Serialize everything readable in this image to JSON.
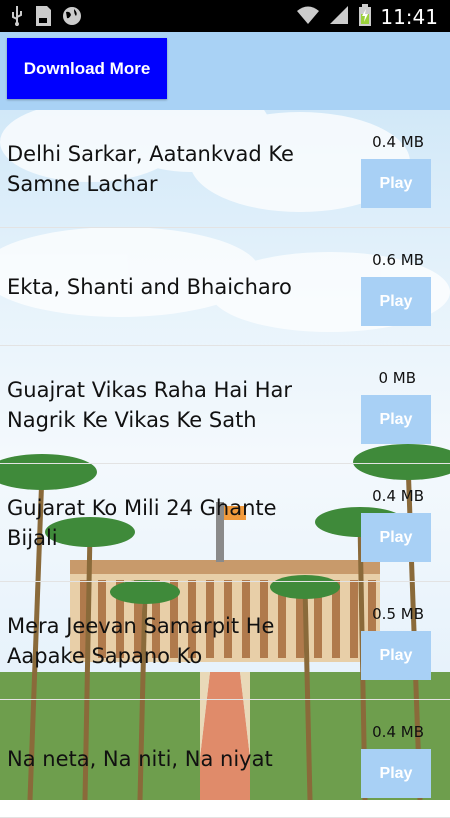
{
  "status_bar": {
    "time": "11:41",
    "icons": [
      "usb-icon",
      "sd-card-icon",
      "globe-icon",
      "wifi-icon",
      "signal-icon",
      "battery-charging-icon"
    ]
  },
  "header": {
    "download_label": "Download More"
  },
  "items": [
    {
      "title": "Delhi Sarkar, Aatankvad Ke Samne Lachar",
      "size": "0.4 MB",
      "play_label": "Play"
    },
    {
      "title": "Ekta, Shanti and Bhaicharo",
      "size": "0.6 MB",
      "play_label": "Play"
    },
    {
      "title": "Guajrat Vikas Raha Hai Har Nagrik Ke Vikas Ke Sath",
      "size": "0 MB",
      "play_label": "Play"
    },
    {
      "title": "Gujarat Ko Mili 24 Ghante Bijali",
      "size": "0.4 MB",
      "play_label": "Play"
    },
    {
      "title": "Mera Jeevan Samarpit He Aapake Sapano Ko",
      "size": "0.5 MB",
      "play_label": "Play"
    },
    {
      "title": "Na neta, Na niti, Na niyat",
      "size": "0.4 MB",
      "play_label": "Play"
    }
  ],
  "colors": {
    "header_bg": "#a9d2f5",
    "download_button": "#0000ff",
    "play_button": "#a8d0f5",
    "status_bar": "#000000"
  }
}
